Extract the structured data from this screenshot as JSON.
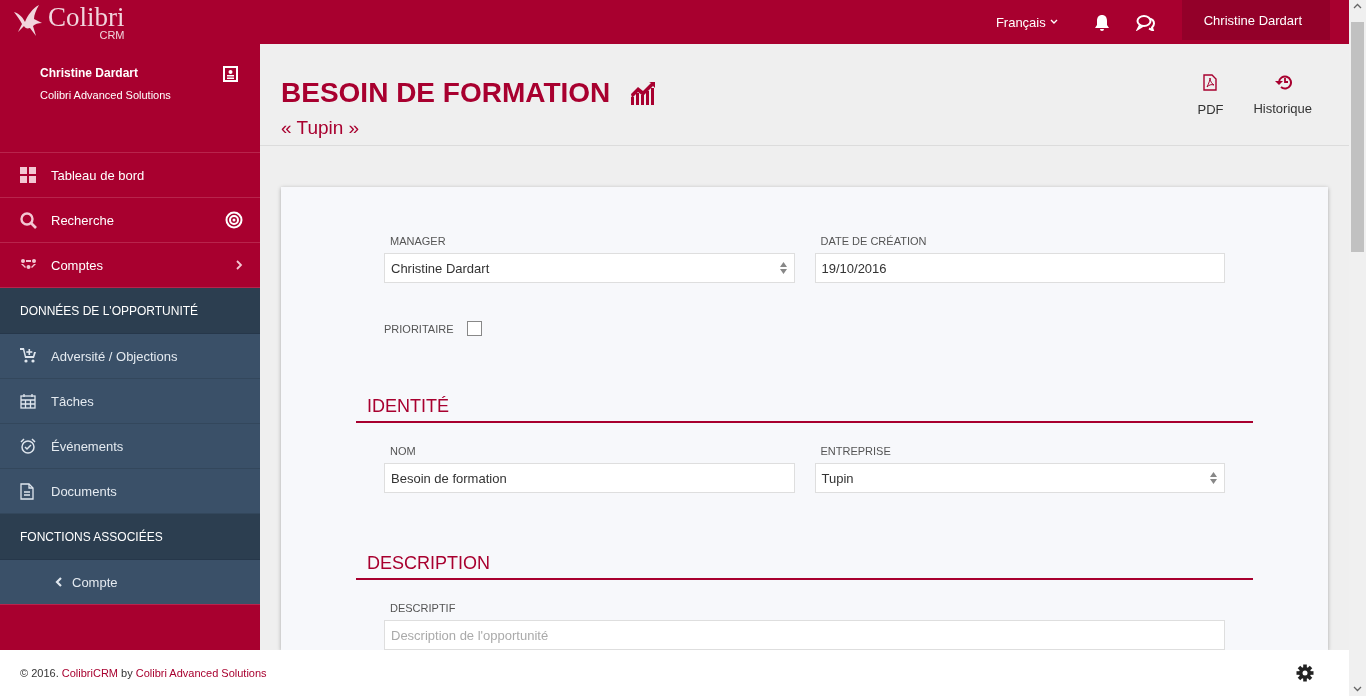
{
  "topbar": {
    "logo": {
      "name": "Colibri",
      "sub": "CRM"
    },
    "language": "Français",
    "user": "Christine Dardart"
  },
  "sidebar": {
    "profile": {
      "name": "Christine Dardart",
      "company": "Colibri Advanced Solutions"
    },
    "items": [
      {
        "kind": "item",
        "label": "Tableau de bord"
      },
      {
        "kind": "item",
        "label": "Recherche"
      },
      {
        "kind": "item",
        "label": "Comptes"
      },
      {
        "kind": "header",
        "label": "DONNÉES DE L'OPPORTUNITÉ"
      },
      {
        "kind": "subitem",
        "label": "Adversité / Objections"
      },
      {
        "kind": "subitem",
        "label": "Tâches"
      },
      {
        "kind": "subitem",
        "label": "Événements"
      },
      {
        "kind": "subitem",
        "label": "Documents"
      },
      {
        "kind": "header",
        "label": "FONCTIONS ASSOCIÉES"
      },
      {
        "kind": "back",
        "label": "Compte"
      }
    ]
  },
  "page": {
    "title": "BESOIN DE FORMATION",
    "subtitle": "« Tupin »",
    "actions": [
      {
        "label": "PDF"
      },
      {
        "label": "Historique"
      }
    ]
  },
  "form": {
    "fields": [
      {
        "kind": "select",
        "label": "MANAGER",
        "value": "Christine Dardart"
      },
      {
        "kind": "text",
        "label": "DATE DE CRÉATION",
        "value": "19/10/2016"
      }
    ],
    "checkbox": {
      "label": "PRIORITAIRE",
      "checked": false
    },
    "sections": [
      {
        "title": "IDENTITÉ",
        "fields": [
          {
            "kind": "text",
            "label": "NOM",
            "value": "Besoin de formation"
          },
          {
            "kind": "select",
            "label": "ENTREPRISE",
            "value": "Tupin"
          }
        ]
      },
      {
        "title": "DESCRIPTION",
        "fields": [
          {
            "kind": "textarea",
            "label": "DESCRIPTIF",
            "placeholder": "Description de l'opportunité"
          }
        ]
      }
    ]
  },
  "footer": {
    "prefix": "© 2016.",
    "product": "ColibriCRM",
    "by": "by",
    "company": "Colibri Advanced Solutions"
  }
}
